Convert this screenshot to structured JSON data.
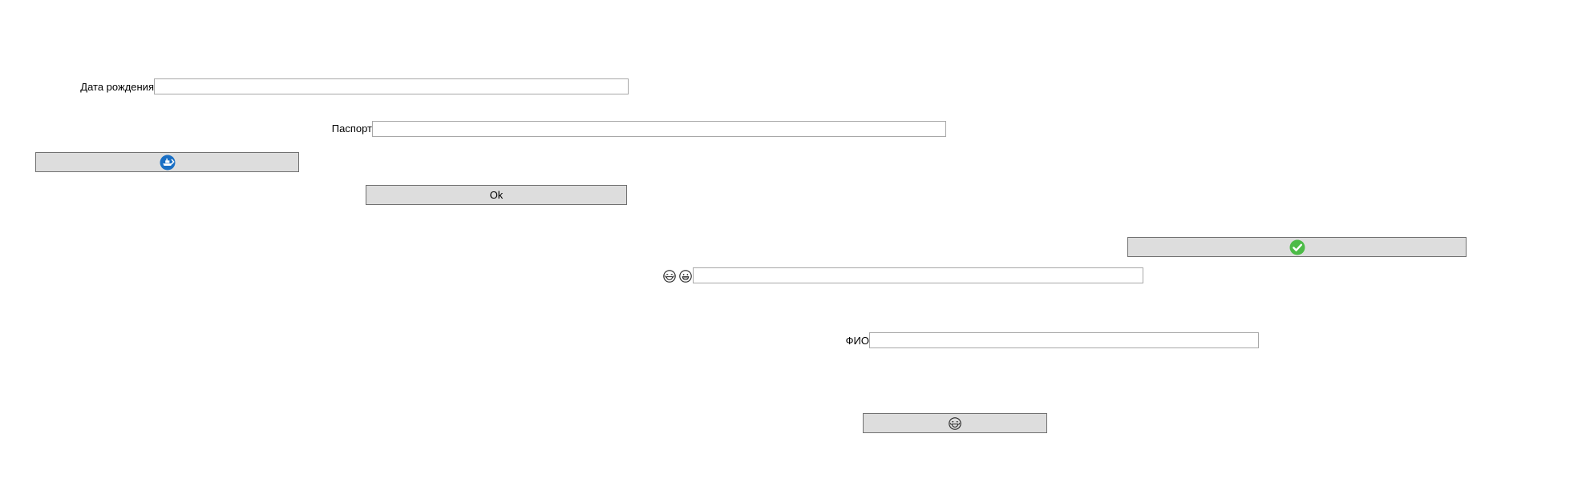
{
  "form": {
    "birth_date": {
      "label": "Дата рождения",
      "value": "",
      "placeholder": ""
    },
    "passport": {
      "label": "Паспорт",
      "value": "",
      "placeholder": ""
    },
    "emoji_field": {
      "value": "",
      "placeholder": "",
      "icons": [
        "laughing-face-icon",
        "smiling-face-icon"
      ]
    },
    "full_name": {
      "label": "ФИО",
      "value": "",
      "placeholder": ""
    }
  },
  "buttons": {
    "ship_button": {
      "icon": "ship-icon",
      "icon_color": "#1a6fc4"
    },
    "ok_button": {
      "label": "Ok"
    },
    "check_button": {
      "icon": "checkmark-icon",
      "icon_color": "#4cbb47"
    },
    "emoji_button": {
      "icon": "laughing-face-icon"
    }
  },
  "colors": {
    "button_bg": "#dddddd",
    "button_border": "#707070",
    "field_border": "#a8a8a8"
  }
}
